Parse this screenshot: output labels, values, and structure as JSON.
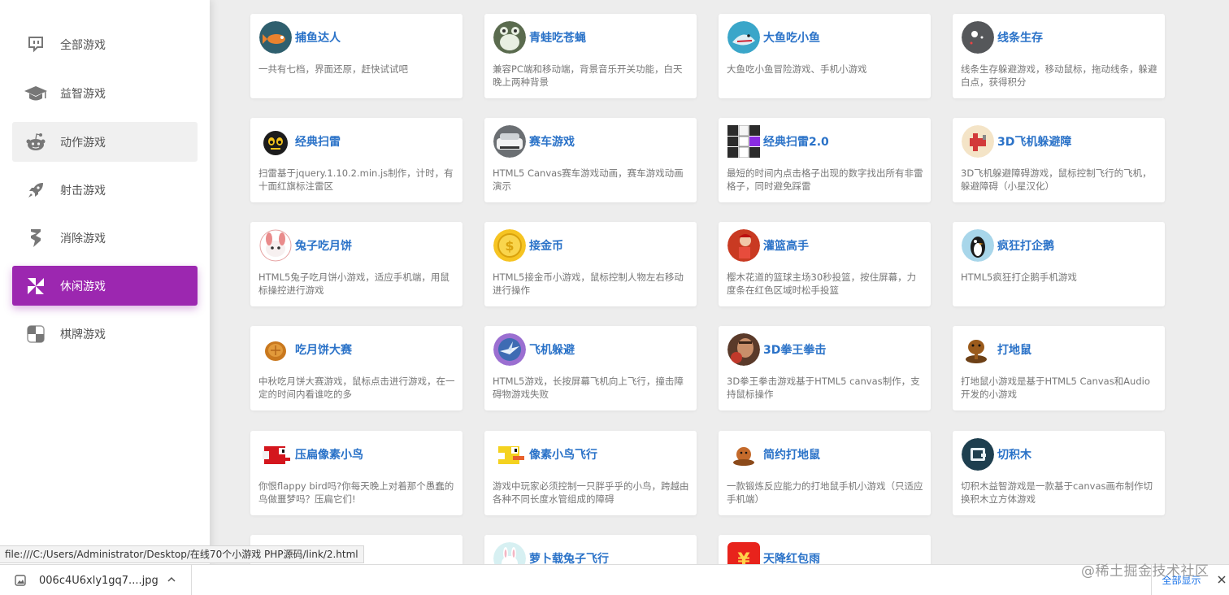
{
  "sidebar": {
    "items": [
      {
        "label": "全部游戏",
        "icon": "tv-chat-icon"
      },
      {
        "label": "益智游戏",
        "icon": "graduation-cap-icon"
      },
      {
        "label": "动作游戏",
        "icon": "reddit-icon"
      },
      {
        "label": "射击游戏",
        "icon": "rocket-icon"
      },
      {
        "label": "消除游戏",
        "icon": "lightning-icon"
      },
      {
        "label": "休闲游戏",
        "icon": "pinwheel-icon"
      },
      {
        "label": "棋牌游戏",
        "icon": "checker-icon"
      }
    ],
    "active_index": 5,
    "hover_index": 2,
    "active_color": "#9c27b0"
  },
  "games": [
    {
      "title": "捕鱼达人",
      "desc": "一共有七档，界面还原，赶快试试吧",
      "icon": "fish-icon"
    },
    {
      "title": "青蛙吃苍蝇",
      "desc": "兼容PC端和移动端，背景音乐开关功能，白天晚上两种背景",
      "icon": "frog-icon"
    },
    {
      "title": "大鱼吃小鱼",
      "desc": "大鱼吃小鱼冒险游戏、手机小游戏",
      "icon": "shark-icon"
    },
    {
      "title": "线条生存",
      "desc": "线条生存躲避游戏，移动鼠标，拖动线条，躲避白点，获得积分",
      "icon": "dots-icon"
    },
    {
      "title": "经典扫雷",
      "desc": "扫雷基于jquery.1.10.2.min.js制作，计时，有十面红旗标注雷区",
      "icon": "bomb-icon"
    },
    {
      "title": "赛车游戏",
      "desc": "HTML5 Canvas赛车游戏动画，赛车游戏动画演示",
      "icon": "car-icon"
    },
    {
      "title": "经典扫雷2.0",
      "desc": "最短的时间内点击格子出现的数字找出所有非雷格子，同时避免踩雷",
      "icon": "grid-icon"
    },
    {
      "title": "3D飞机躲避障",
      "desc": "3D飞机躲避障碍游戏，鼠标控制飞行的飞机，躲避障碍（小星汉化）",
      "icon": "plane-icon"
    },
    {
      "title": "兔子吃月饼",
      "desc": "HTML5兔子吃月饼小游戏，适应手机端，用鼠标操控进行游戏",
      "icon": "rabbit-icon"
    },
    {
      "title": "接金币",
      "desc": "HTML5接金币小游戏，鼠标控制人物左右移动进行操作",
      "icon": "coin-icon"
    },
    {
      "title": "灌篮高手",
      "desc": "樱木花道的篮球主场30秒投篮，按住屏幕，力度条在红色区域时松手投篮",
      "icon": "basketball-icon"
    },
    {
      "title": "疯狂打企鹅",
      "desc": "HTML5疯狂打企鹅手机游戏",
      "icon": "penguin-icon"
    },
    {
      "title": "吃月饼大赛",
      "desc": "中秋吃月饼大赛游戏，鼠标点击进行游戏，在一定的时间内看谁吃的多",
      "icon": "mooncake-icon"
    },
    {
      "title": "飞机躲避",
      "desc": "HTML5游戏，长按屏幕飞机向上飞行，撞击障碍物游戏失败",
      "icon": "jet-icon"
    },
    {
      "title": "3D拳王拳击",
      "desc": "3D拳王拳击游戏基于HTML5 canvas制作，支持鼠标操作",
      "icon": "boxer-icon"
    },
    {
      "title": "打地鼠",
      "desc": "打地鼠小游戏是基于HTML5 Canvas和Audio开发的小游戏",
      "icon": "mole-icon"
    },
    {
      "title": "压扁像素小鸟",
      "desc": "你恨flappy bird吗?你每天晚上对着那个愚蠢的鸟做噩梦吗？压扁它们!",
      "icon": "red-bird-icon"
    },
    {
      "title": "像素小鸟飞行",
      "desc": "游戏中玩家必须控制一只胖乎乎的小鸟，跨越由各种不同长度水管组成的障碍",
      "icon": "yellow-bird-icon"
    },
    {
      "title": "简约打地鼠",
      "desc": "一款锻炼反应能力的打地鼠手机小游戏（只适应手机端）",
      "icon": "mole-small-icon"
    },
    {
      "title": "切积木",
      "desc": "切积木益智游戏是一款基于canvas画布制作切换积木立方体游戏",
      "icon": "block-icon"
    },
    {
      "title": "",
      "desc": "",
      "icon": "partial-icon"
    },
    {
      "title": "萝卜载兔子飞行",
      "desc": "",
      "icon": "bunny-icon"
    },
    {
      "title": "天降红包雨",
      "desc": "",
      "icon": "red-envelope-icon"
    }
  ],
  "statusbar": {
    "url": "file:///C:/Users/Administrator/Desktop/在线70个小游戏 PHP源码/link/2.html"
  },
  "downloads": {
    "filename": "006c4U6xly1gq7....jpg",
    "show_all": "全部显示"
  },
  "watermark": "@稀土掘金技术社区"
}
